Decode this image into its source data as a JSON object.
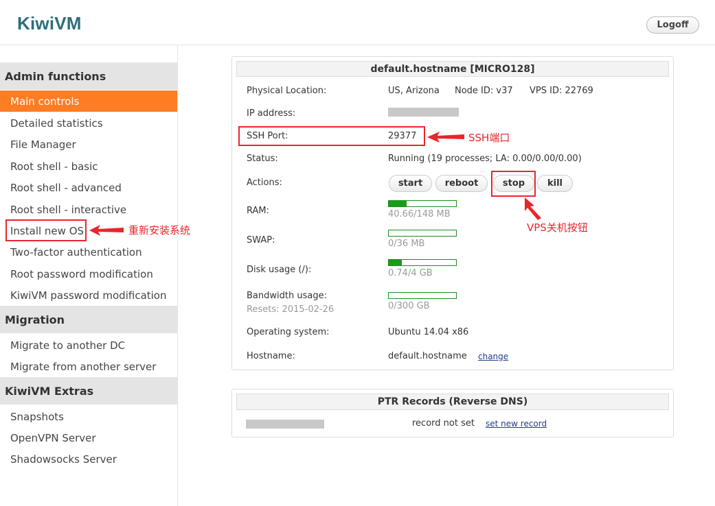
{
  "header": {
    "logo": "KiwiVM",
    "logoff_label": "Logoff"
  },
  "sidebar": {
    "sections": [
      {
        "title": "Admin functions",
        "items": [
          "Main controls",
          "Detailed statistics",
          "File Manager",
          "Root shell - basic",
          "Root shell - advanced",
          "Root shell - interactive",
          "Install new OS",
          "Two-factor authentication",
          "Root password modification",
          "KiwiVM password modification"
        ]
      },
      {
        "title": "Migration",
        "items": [
          "Migrate to another DC",
          "Migrate from another server"
        ]
      },
      {
        "title": "KiwiVM Extras",
        "items": [
          "Snapshots",
          "OpenVPN Server",
          "Shadowsocks Server"
        ]
      }
    ],
    "active_item": "Main controls"
  },
  "main_panel": {
    "title": "default.hostname   [MICRO128]",
    "physical_location": {
      "label": "Physical Location:",
      "location": "US, Arizona",
      "node_id": "Node ID: v37",
      "vps_id": "VPS ID: 22769"
    },
    "ip_address": {
      "label": "IP address:"
    },
    "ssh_port": {
      "label": "SSH Port:",
      "value": "29377"
    },
    "status": {
      "label": "Status:",
      "value": "Running (19 processes; LA: 0.00/0.00/0.00)"
    },
    "actions": {
      "label": "Actions:",
      "buttons": [
        "start",
        "reboot",
        "stop",
        "kill"
      ]
    },
    "ram": {
      "label": "RAM:",
      "usage_text": "40.66/148 MB",
      "fraction": 0.27
    },
    "swap": {
      "label": "SWAP:",
      "usage_text": "0/36 MB",
      "fraction": 0
    },
    "disk": {
      "label": "Disk usage (/):",
      "usage_text": "0.74/4 GB",
      "fraction": 0.19
    },
    "bandwidth": {
      "label": "Bandwidth usage:",
      "resets": "Resets: 2015-02-26",
      "usage_text": "0/300 GB",
      "fraction": 0
    },
    "os": {
      "label": "Operating system:",
      "value": "Ubuntu 14.04 x86"
    },
    "hostname": {
      "label": "Hostname:",
      "value": "default.hostname",
      "change_link": "change"
    }
  },
  "ptr_panel": {
    "title": "PTR Records (Reverse DNS)",
    "record_status": "record not set",
    "set_link": "set new record"
  },
  "annotations": {
    "ssh_note": "SSH端口",
    "install_os_note": "重新安装系统",
    "stop_note": "VPS关机按钮",
    "color": "#e8262c"
  },
  "colors": {
    "accent": "#fe7c24",
    "logo": "#2b6f7b",
    "bar": "#1a9b1a"
  }
}
